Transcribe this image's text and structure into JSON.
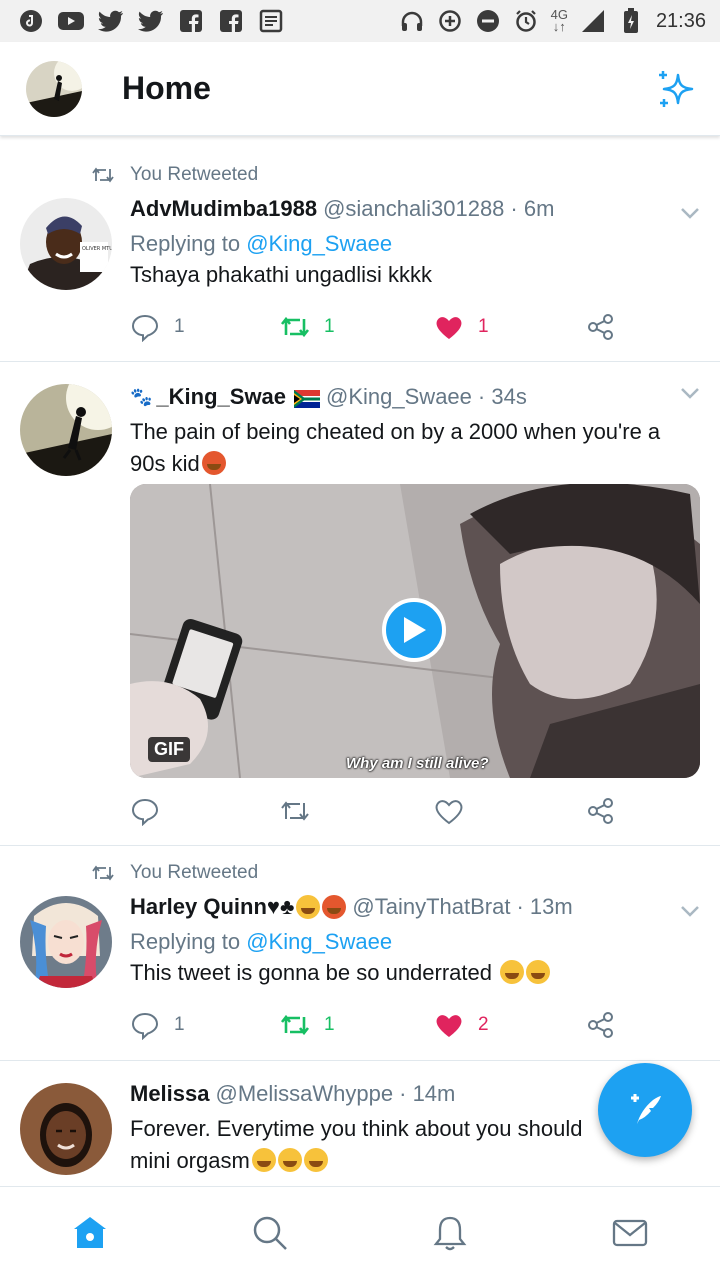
{
  "status_bar": {
    "network": "4G",
    "time": "21:36"
  },
  "header": {
    "title": "Home"
  },
  "tweets": [
    {
      "retweet_label": "You Retweeted",
      "display_name": "AdvMudimba1988",
      "handle": "@sianchali301288",
      "time": "· 6m",
      "replying_prefix": "Replying to",
      "replying_handle": "@King_Swaee",
      "text": "Tshaya phakathi ungadlisi kkkk",
      "replies": "1",
      "retweets": "1",
      "likes": "1"
    },
    {
      "display_name": "_King_Swae",
      "handle": "@King_Swaee",
      "time": "· 34s",
      "text": "The pain of being cheated on by a 2000 when you're a 90s kid",
      "media": {
        "badge": "GIF",
        "caption": "Why am I still alive?"
      }
    },
    {
      "retweet_label": "You Retweeted",
      "display_name": "Harley Quinn♥♣",
      "handle": "@TainyThatBrat",
      "time": "· 13m",
      "replying_prefix": "Replying to",
      "replying_handle": "@King_Swaee",
      "text": "This tweet is gonna be so underrated",
      "replies": "1",
      "retweets": "1",
      "likes": "2"
    },
    {
      "display_name": "Melissa",
      "handle": "@MelissaWhyppe",
      "time": "· 14m",
      "text_line1": "Forever. Everytime you think about you should",
      "text_line2": "mini orgasm"
    }
  ],
  "colors": {
    "accent": "#1da1f2",
    "retweet": "#17bf63",
    "like": "#e0245e",
    "muted": "#657786"
  },
  "icons": [
    "home-icon",
    "search-icon",
    "notifications-icon",
    "messages-icon",
    "compose-tweet-icon",
    "sparkle-icon"
  ]
}
